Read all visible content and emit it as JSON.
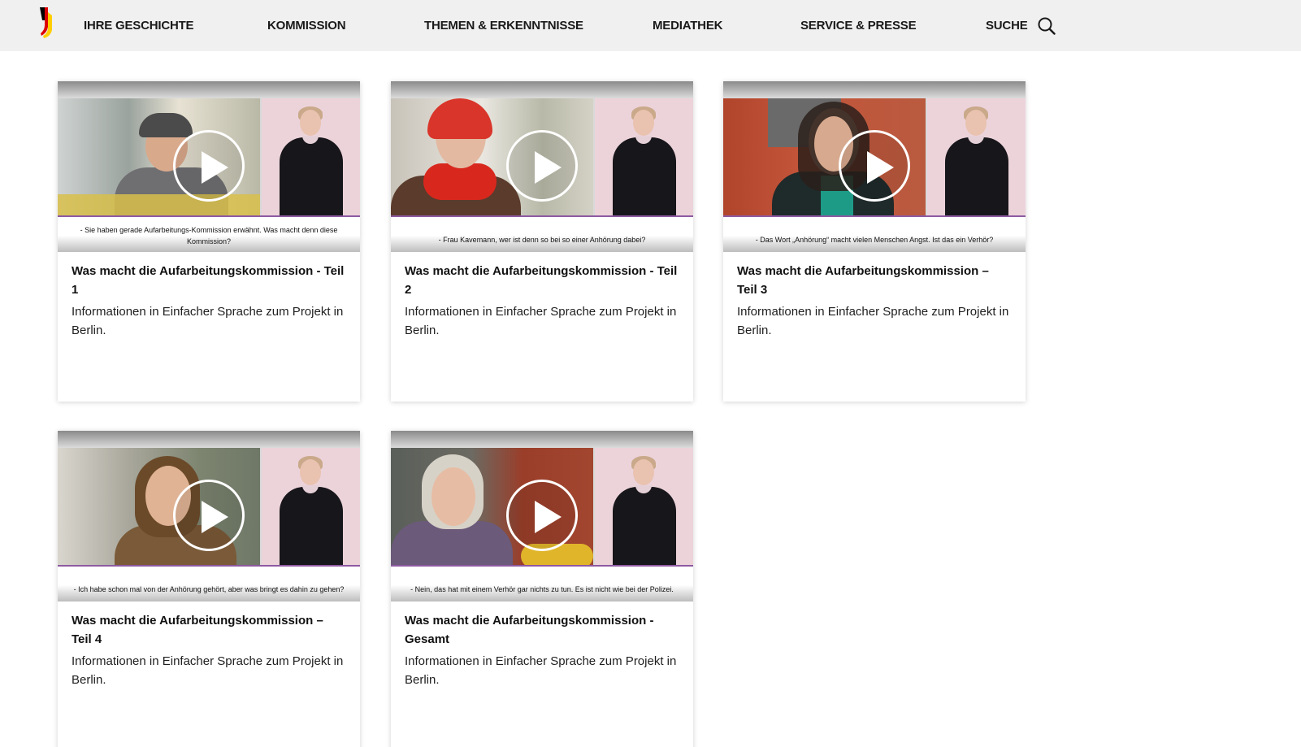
{
  "header": {
    "logo_icon": "bundesadler-flag-logo-icon",
    "nav": [
      {
        "label": "IHRE GESCHICHTE"
      },
      {
        "label": "KOMMISSION"
      },
      {
        "label": "THEMEN & ERKENNTNISSE"
      },
      {
        "label": "MEDIATHEK"
      },
      {
        "label": "SERVICE & PRESSE"
      }
    ],
    "search_label": "SUCHE",
    "search_icon": "search-icon"
  },
  "cards": [
    {
      "title": "Was macht die Aufarbeitungskommission - Teil 1",
      "description": "Informationen in Einfacher Sprache zum Projekt in Berlin.",
      "caption": "- Sie haben gerade Aufarbeitungs-Kommission erwähnt. Was macht denn diese Kommission?",
      "icon": "play-icon"
    },
    {
      "title": "Was macht die Aufarbeitungskommission - Teil 2",
      "description": "Informationen in Einfacher Sprache zum Projekt in Berlin.",
      "caption": "- Frau Kavemann, wer ist denn so bei so einer Anhörung dabei?",
      "icon": "play-icon"
    },
    {
      "title": "Was macht die Aufarbeitungskommission – Teil 3",
      "description": "Informationen in Einfacher Sprache zum Projekt in Berlin.",
      "caption": "- Das Wort „Anhörung“ macht vielen Menschen Angst. Ist das ein Verhör?",
      "icon": "play-icon"
    },
    {
      "title": "Was macht die Aufarbeitungskommission – Teil 4",
      "description": "Informationen in Einfacher Sprache zum Projekt in Berlin.",
      "caption": "- Ich habe schon mal von der Anhörung gehört, aber was bringt es dahin zu gehen?",
      "icon": "play-icon"
    },
    {
      "title": "Was macht die Aufarbeitungskommission - Gesamt",
      "description": "Informationen in Einfacher Sprache zum Projekt in Berlin.",
      "caption": "- Nein, das hat mit einem Verhör gar nichts zu tun. Es ist nicht wie bei der Polizei.",
      "icon": "play-icon"
    }
  ],
  "colors": {
    "header_bg": "#f0f0f0",
    "caption_rule": "#8e5aa2",
    "signer_bg": "#ecd3da",
    "flag_black": "#000000",
    "flag_red": "#dd0000",
    "flag_gold": "#ffce00"
  }
}
